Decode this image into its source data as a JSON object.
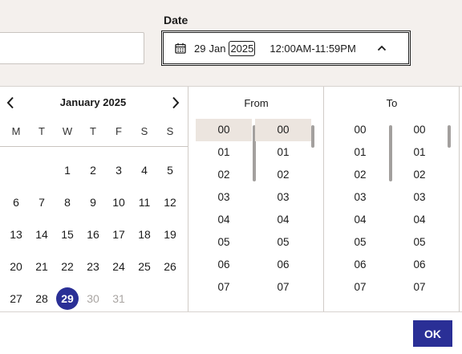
{
  "date_field": {
    "label": "Date",
    "day": "29",
    "month": "Jan",
    "year": "2025",
    "time_range": "12:00AM-11:59PM"
  },
  "calendar": {
    "month_title": "January 2025",
    "weekdays": [
      "M",
      "T",
      "W",
      "T",
      "F",
      "S",
      "S"
    ],
    "weeks": [
      [
        "",
        "",
        "1",
        "2",
        "3",
        "4",
        "5"
      ],
      [
        "6",
        "7",
        "8",
        "9",
        "10",
        "11",
        "12"
      ],
      [
        "13",
        "14",
        "15",
        "16",
        "17",
        "18",
        "19"
      ],
      [
        "20",
        "21",
        "22",
        "23",
        "24",
        "25",
        "26"
      ],
      [
        "27",
        "28",
        "29",
        "30",
        "31",
        "",
        ""
      ]
    ],
    "selected_day": "29",
    "muted_days": [
      "30",
      "31"
    ]
  },
  "from": {
    "title": "From",
    "hours": [
      "00",
      "01",
      "02",
      "03",
      "04",
      "05",
      "06",
      "07"
    ],
    "minutes": [
      "00",
      "01",
      "02",
      "03",
      "04",
      "05",
      "06",
      "07"
    ],
    "selected_hour": "00",
    "selected_minute": "00"
  },
  "to": {
    "title": "To",
    "hours": [
      "00",
      "01",
      "02",
      "03",
      "04",
      "05",
      "06",
      "07"
    ],
    "minutes": [
      "00",
      "01",
      "02",
      "03",
      "04",
      "05",
      "06",
      "07"
    ]
  },
  "ok_label": "OK",
  "colors": {
    "accent": "#2a2f96",
    "selection_bg": "#ece5df",
    "page_bg": "#f4f0ed"
  }
}
